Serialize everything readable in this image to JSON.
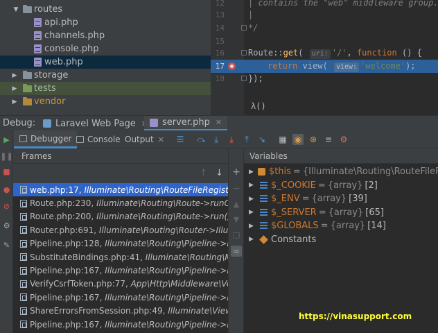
{
  "project_tree": {
    "items": [
      {
        "label": "routes",
        "kind": "folder",
        "expanded": true
      },
      {
        "label": "api.php",
        "kind": "file"
      },
      {
        "label": "channels.php",
        "kind": "file"
      },
      {
        "label": "console.php",
        "kind": "file"
      },
      {
        "label": "web.php",
        "kind": "file",
        "selected": true
      },
      {
        "label": "storage",
        "kind": "folder"
      },
      {
        "label": "tests",
        "kind": "folder",
        "color": "green"
      },
      {
        "label": "vendor",
        "kind": "folder",
        "color": "orange"
      }
    ]
  },
  "editor": {
    "lines": [
      {
        "num": "12",
        "comment": "| contains the \"web\" middleware group."
      },
      {
        "num": "13",
        "comment": "|"
      },
      {
        "num": "14",
        "comment": "*/"
      },
      {
        "num": "15",
        "comment": ""
      },
      {
        "num": "16",
        "code": "Route::get( uri: '/', function () {"
      },
      {
        "num": "17",
        "code": "return view( view: 'welcome');",
        "breakpoint": true,
        "execution_point": true
      },
      {
        "num": "18",
        "code": "});"
      }
    ],
    "tokens": {
      "route": "Route",
      "dcolon": "::",
      "get": "get",
      "open": "( ",
      "uri_hint": "uri:",
      "slash_str": "'/'",
      "comma": ", ",
      "function_kw": "function",
      "fn_rest": " () {",
      "return_kw": "return",
      "view_fn": " view( ",
      "view_hint": "view:",
      "welcome_str": "'welcome'",
      "close_semi": ");",
      "close_block": "});"
    },
    "breadcrumb": "λ()"
  },
  "debug_window": {
    "title": "Debug:",
    "sessions": [
      {
        "label": "Laravel Web Page",
        "active": false
      },
      {
        "label": "server.php",
        "active": true
      }
    ],
    "tabs": [
      {
        "label": "Debugger",
        "active": true
      },
      {
        "label": "Console",
        "active": false
      },
      {
        "label": "Output",
        "active": false
      }
    ]
  },
  "frames": {
    "header": "Frames",
    "rows": [
      {
        "file": "web.php:17,",
        "detail": "Illuminate\\Routing\\RouteFileRegistrar",
        "selected": true
      },
      {
        "file": "Route.php:230,",
        "detail": "Illuminate\\Routing\\Route->runCallable()"
      },
      {
        "file": "Route.php:200,",
        "detail": "Illuminate\\Routing\\Route->run()"
      },
      {
        "file": "Router.php:691,",
        "detail": "Illuminate\\Routing\\Router->Illuminate"
      },
      {
        "file": "Pipeline.php:128,",
        "detail": "Illuminate\\Routing\\Pipeline->Illuminate"
      },
      {
        "file": "SubstituteBindings.php:41,",
        "detail": "Illuminate\\Routing\\Middleware"
      },
      {
        "file": "Pipeline.php:167,",
        "detail": "Illuminate\\Routing\\Pipeline->Illuminate"
      },
      {
        "file": "VerifyCsrfToken.php:77,",
        "detail": "App\\Http\\Middleware\\VerifyCsrfToken"
      },
      {
        "file": "Pipeline.php:167,",
        "detail": "Illuminate\\Routing\\Pipeline->Illuminate"
      },
      {
        "file": "ShareErrorsFromSession.php:49,",
        "detail": "Illuminate\\View"
      },
      {
        "file": "Pipeline.php:167,",
        "detail": "Illuminate\\Routing\\Pipeline->Illuminate"
      }
    ]
  },
  "variables": {
    "header": "Variables",
    "rows": [
      {
        "name": "$this",
        "eq": "=",
        "type": "{Illuminate\\Routing\\RouteFileRegistrar}",
        "value": "",
        "icon": "obj"
      },
      {
        "name": "$_COOKIE",
        "eq": "=",
        "type": "{array}",
        "value": "[2]",
        "icon": "bars"
      },
      {
        "name": "$_ENV",
        "eq": "=",
        "type": "{array}",
        "value": "[39]",
        "icon": "bars"
      },
      {
        "name": "$_SERVER",
        "eq": "=",
        "type": "{array}",
        "value": "[65]",
        "icon": "bars"
      },
      {
        "name": "$GLOBALS",
        "eq": "=",
        "type": "{array}",
        "value": "[14]",
        "icon": "bars"
      },
      {
        "name": "",
        "eq": "",
        "type": "",
        "value": "Constants",
        "icon": "const"
      }
    ]
  },
  "watermark": "https://vinasupport.com",
  "colors": {
    "accent": "#2f65ca",
    "execution_line": "#2d6099",
    "breakpoint": "#c75450",
    "watermark": "#ffff3a"
  }
}
